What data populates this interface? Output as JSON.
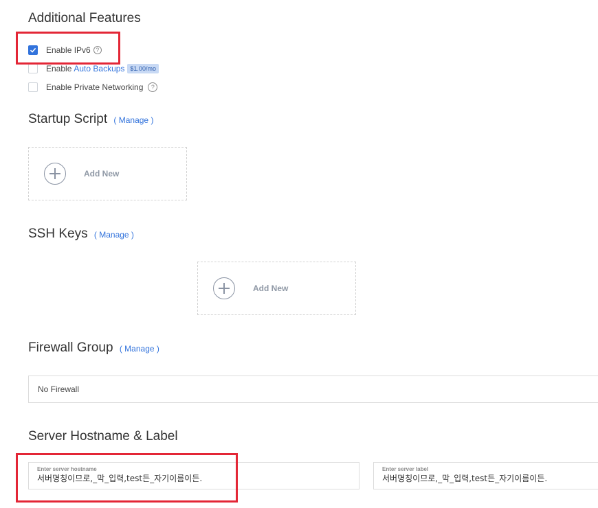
{
  "additional_features": {
    "title": "Additional Features",
    "ipv6": {
      "label": "Enable IPv6",
      "checked": true
    },
    "backups": {
      "label_prefix": "Enable",
      "link_text": "Auto Backups",
      "price": "$1.00/mo",
      "checked": false
    },
    "private_networking": {
      "label": "Enable Private Networking",
      "checked": false
    },
    "help_glyph": "?"
  },
  "startup_script": {
    "title": "Startup Script",
    "manage_open": "( ",
    "manage_label": "Manage",
    "manage_close": " )",
    "add_new_label": "Add New"
  },
  "ssh_keys": {
    "title": "SSH Keys",
    "manage_open": "( ",
    "manage_label": "Manage",
    "manage_close": " )",
    "add_new_label": "Add New"
  },
  "firewall_group": {
    "title": "Firewall Group",
    "manage_open": "( ",
    "manage_label": "Manage",
    "manage_close": " )",
    "selected": "No Firewall"
  },
  "server_hostname_label": {
    "title": "Server Hostname & Label",
    "hostname": {
      "label": "Enter server hostname",
      "value": "서버명칭이므로,_막_입력,test든_자기이름이든."
    },
    "server_label": {
      "label": "Enter server label",
      "value": "서버명칭이므로,_막_입력,test든_자기이름이든."
    }
  },
  "colors": {
    "accent": "#3273dc",
    "highlight": "#e32636",
    "badge_bg": "#c8d9f4"
  }
}
